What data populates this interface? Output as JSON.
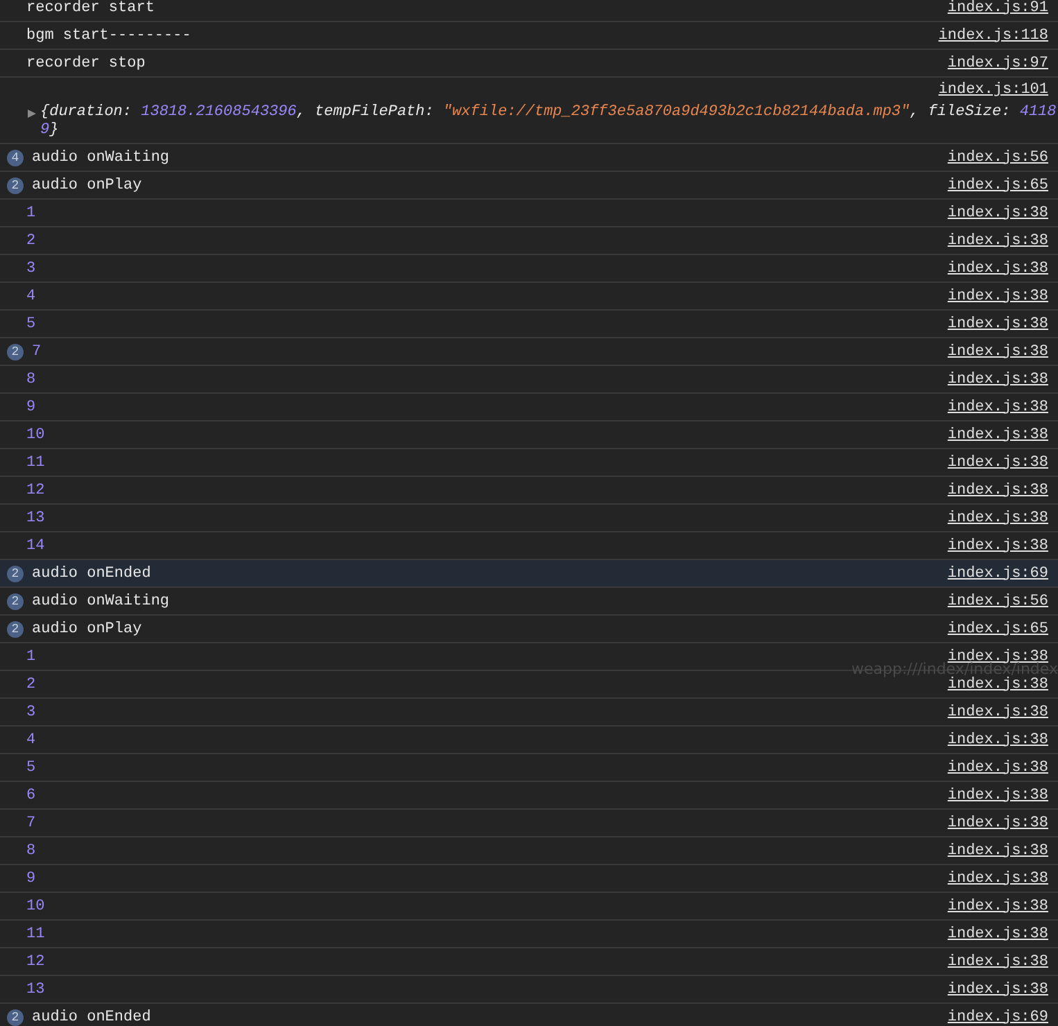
{
  "rows": [
    {
      "kind": "text",
      "text": "recorder start",
      "source": "index.js:91",
      "selected": false
    },
    {
      "kind": "text",
      "text": "bgm start---------",
      "source": "index.js:118",
      "selected": false
    },
    {
      "kind": "text",
      "text": "recorder stop",
      "source": "index.js:97",
      "selected": false
    },
    {
      "kind": "object",
      "source": "index.js:101",
      "selected": false,
      "expanded": false,
      "lines": [
        [
          {
            "kind": "key",
            "text": "{duration: "
          },
          {
            "kind": "number",
            "text": "13818.21608543396"
          },
          {
            "kind": "key",
            "text": ", tempFilePath: "
          },
          {
            "kind": "string",
            "text": "\"wxfile://tmp_23ff3e5a870a9d493b2c1cb82144bada.mp3\""
          },
          {
            "kind": "key",
            "text": ", fileSize: "
          },
          {
            "kind": "number",
            "text": "4118"
          }
        ],
        [
          {
            "kind": "number",
            "text": "9"
          },
          {
            "kind": "key",
            "text": "}"
          }
        ]
      ]
    },
    {
      "kind": "text",
      "count": "4",
      "text": "audio onWaiting",
      "source": "index.js:56",
      "selected": false
    },
    {
      "kind": "text",
      "count": "2",
      "text": "audio onPlay",
      "source": "index.js:65",
      "selected": false
    },
    {
      "kind": "number",
      "text": "1",
      "source": "index.js:38",
      "selected": false
    },
    {
      "kind": "number",
      "text": "2",
      "source": "index.js:38",
      "selected": false
    },
    {
      "kind": "number",
      "text": "3",
      "source": "index.js:38",
      "selected": false
    },
    {
      "kind": "number",
      "text": "4",
      "source": "index.js:38",
      "selected": false
    },
    {
      "kind": "number",
      "text": "5",
      "source": "index.js:38",
      "selected": false
    },
    {
      "kind": "number",
      "count": "2",
      "text": "7",
      "source": "index.js:38",
      "selected": false
    },
    {
      "kind": "number",
      "text": "8",
      "source": "index.js:38",
      "selected": false
    },
    {
      "kind": "number",
      "text": "9",
      "source": "index.js:38",
      "selected": false
    },
    {
      "kind": "number",
      "text": "10",
      "source": "index.js:38",
      "selected": false
    },
    {
      "kind": "number",
      "text": "11",
      "source": "index.js:38",
      "selected": false
    },
    {
      "kind": "number",
      "text": "12",
      "source": "index.js:38",
      "selected": false
    },
    {
      "kind": "number",
      "text": "13",
      "source": "index.js:38",
      "selected": false
    },
    {
      "kind": "number",
      "text": "14",
      "source": "index.js:38",
      "selected": false
    },
    {
      "kind": "text",
      "count": "2",
      "text": "audio onEnded",
      "source": "index.js:69",
      "selected": true
    },
    {
      "kind": "text",
      "count": "2",
      "text": "audio onWaiting",
      "source": "index.js:56",
      "selected": false
    },
    {
      "kind": "text",
      "count": "2",
      "text": "audio onPlay",
      "source": "index.js:65",
      "selected": false
    },
    {
      "kind": "number",
      "text": "1",
      "source": "index.js:38",
      "selected": false
    },
    {
      "kind": "number",
      "text": "2",
      "source": "index.js:38",
      "selected": false
    },
    {
      "kind": "number",
      "text": "3",
      "source": "index.js:38",
      "selected": false
    },
    {
      "kind": "number",
      "text": "4",
      "source": "index.js:38",
      "selected": false
    },
    {
      "kind": "number",
      "text": "5",
      "source": "index.js:38",
      "selected": false
    },
    {
      "kind": "number",
      "text": "6",
      "source": "index.js:38",
      "selected": false
    },
    {
      "kind": "number",
      "text": "7",
      "source": "index.js:38",
      "selected": false
    },
    {
      "kind": "number",
      "text": "8",
      "source": "index.js:38",
      "selected": false
    },
    {
      "kind": "number",
      "text": "9",
      "source": "index.js:38",
      "selected": false
    },
    {
      "kind": "number",
      "text": "10",
      "source": "index.js:38",
      "selected": false
    },
    {
      "kind": "number",
      "text": "11",
      "source": "index.js:38",
      "selected": false
    },
    {
      "kind": "number",
      "text": "12",
      "source": "index.js:38",
      "selected": false
    },
    {
      "kind": "number",
      "text": "13",
      "source": "index.js:38",
      "selected": false
    },
    {
      "kind": "text",
      "count": "2",
      "text": "audio onEnded",
      "source": "index.js:69",
      "selected": false
    }
  ],
  "tooltip": "weapp:///index/index/index"
}
